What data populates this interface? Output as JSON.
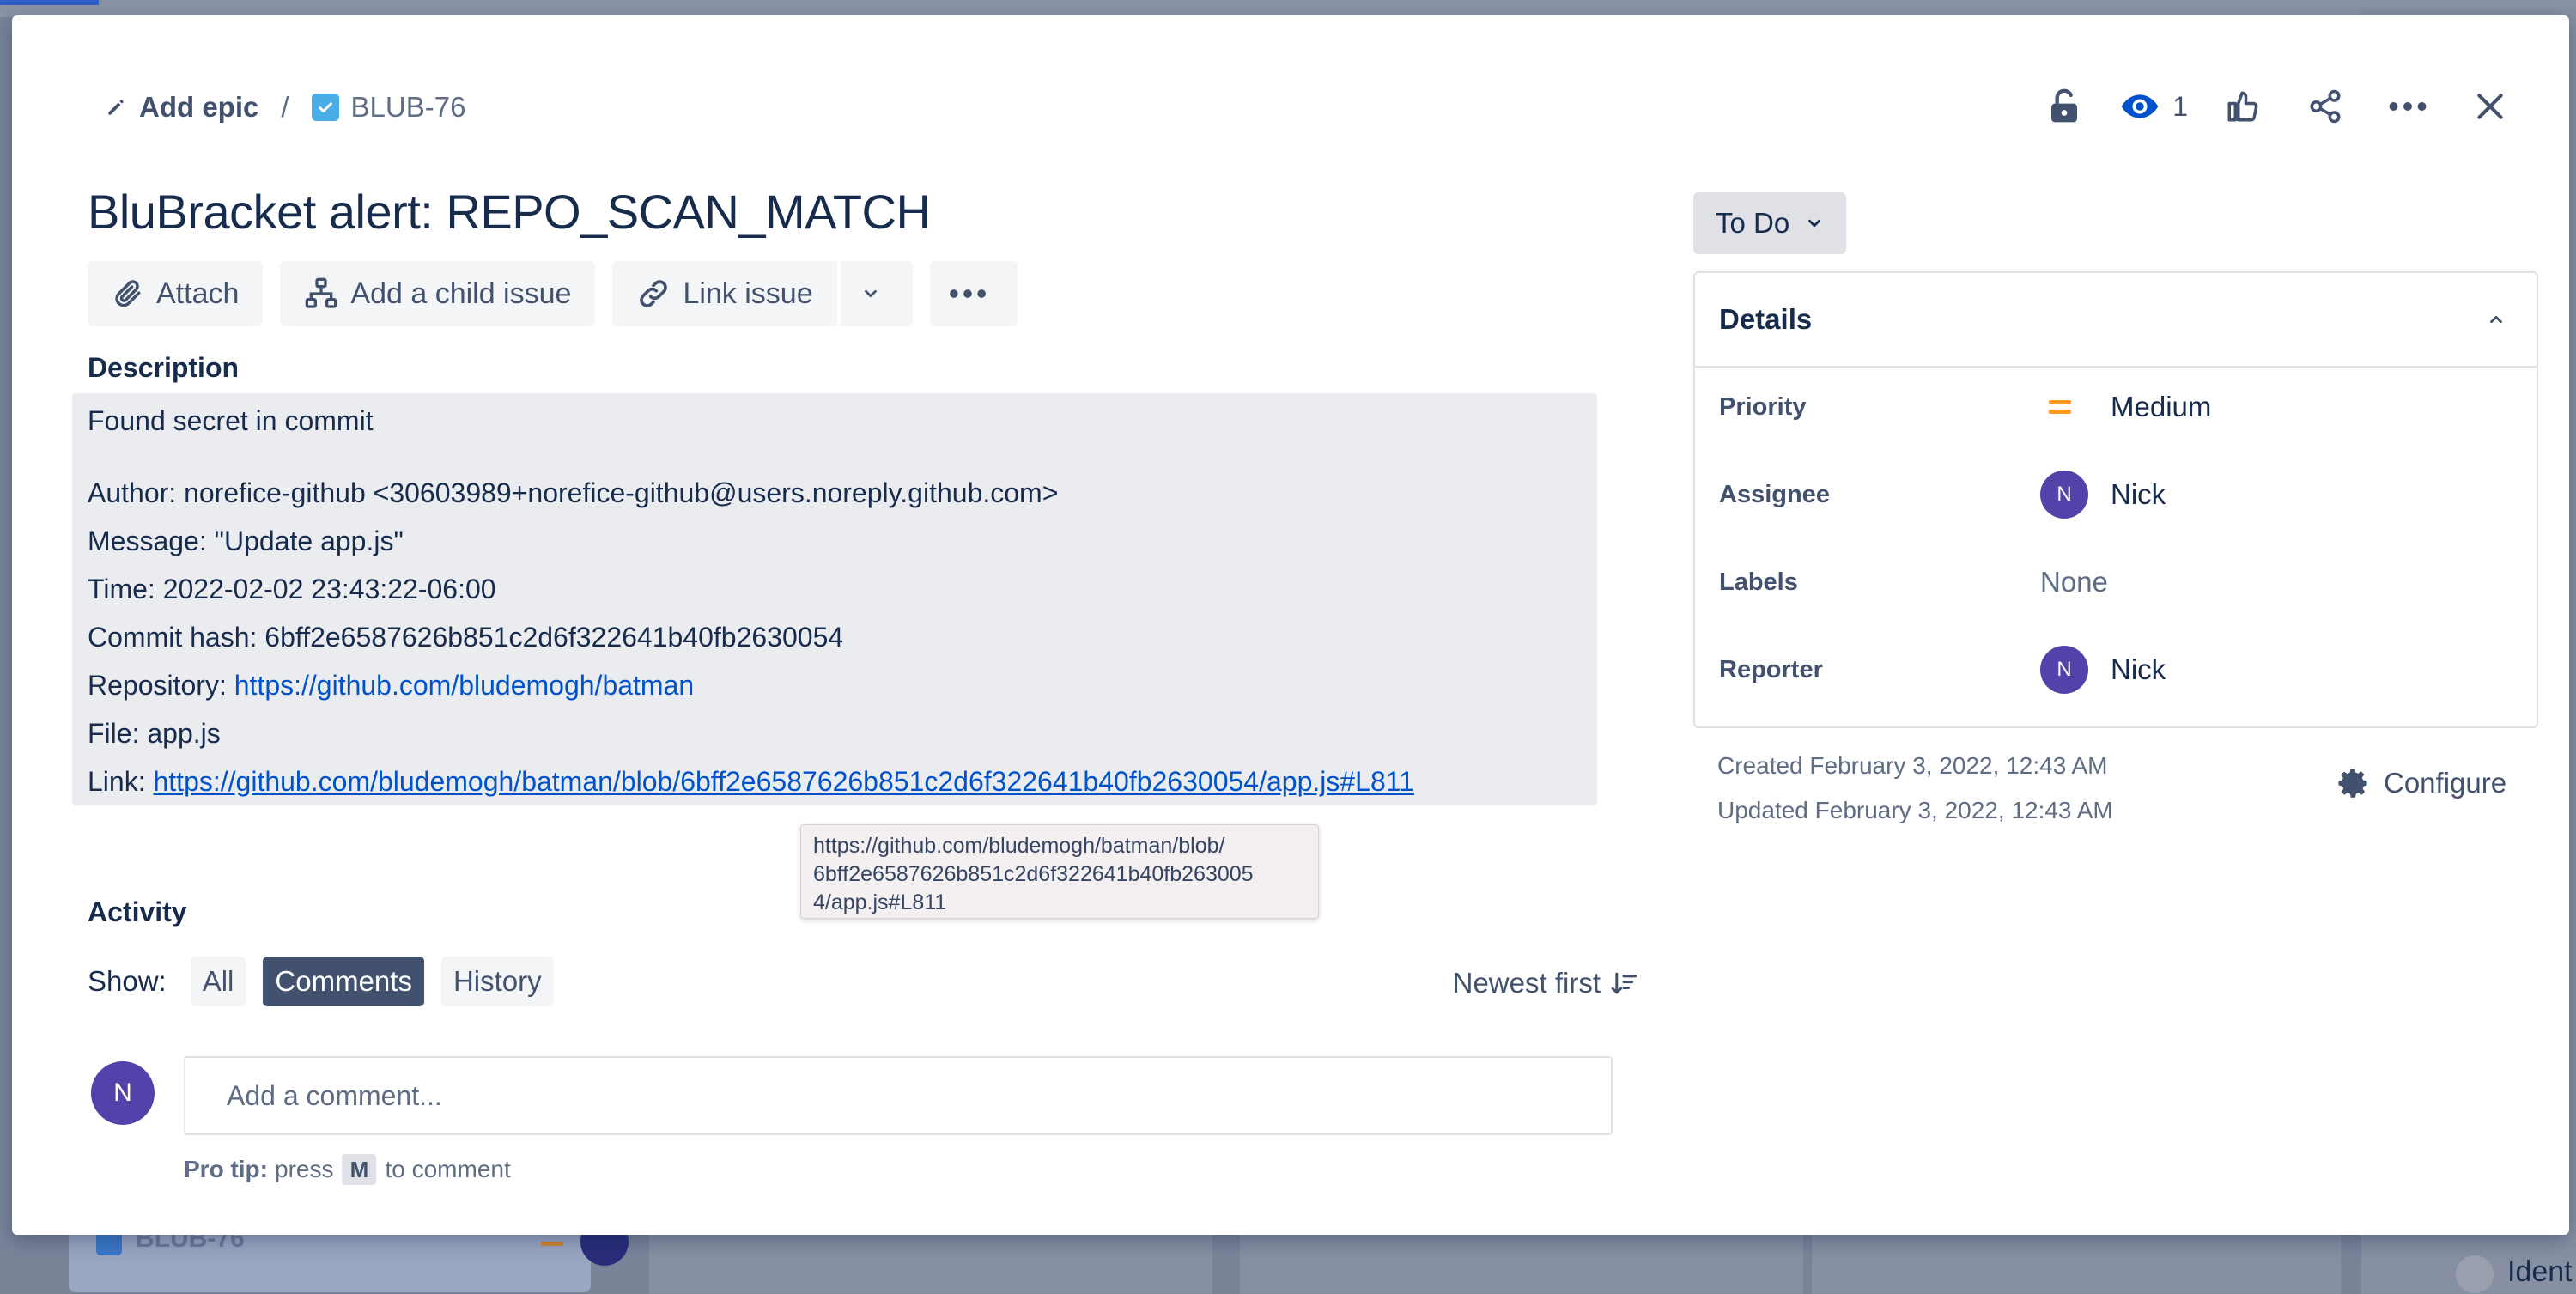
{
  "breadcrumb": {
    "epic_label": "Add epic",
    "separator": "/",
    "issue_key": "BLUB-76"
  },
  "top_actions": {
    "watchers_count": "1"
  },
  "issue": {
    "title": "BluBracket alert: REPO_SCAN_MATCH"
  },
  "toolbar": {
    "attach": "Attach",
    "add_child": "Add a child issue",
    "link_issue": "Link issue"
  },
  "description": {
    "heading": "Description",
    "intro": "Found secret in commit",
    "author": "Author: norefice-github <30603989+norefice-github@users.noreply.github.com>",
    "message": "Message: \"Update app.js\"",
    "time": "Time: 2022-02-02 23:43:22-06:00",
    "commit": "Commit hash: 6bff2e6587626b851c2d6f322641b40fb2630054",
    "repo_prefix": "Repository: ",
    "repo_url": "https://github.com/bludemogh/batman",
    "file": "File: app.js",
    "link_prefix": "Link: ",
    "link_url": "https://github.com/bludemogh/batman/blob/6bff2e6587626b851c2d6f322641b40fb2630054/app.js#L811"
  },
  "tooltip": {
    "text": "https://github.com/bludemogh/batman/blob/\n6bff2e6587626b851c2d6f322641b40fb263005\n4/app.js#L811"
  },
  "activity": {
    "heading": "Activity",
    "show_label": "Show:",
    "filters": [
      "All",
      "Comments",
      "History"
    ],
    "active_filter": "Comments",
    "sort_label": "Newest first"
  },
  "comment": {
    "avatar_initial": "N",
    "placeholder": "Add a comment...",
    "protip_bold": "Pro tip:",
    "protip_pre": "press",
    "protip_key": "M",
    "protip_post": "to comment"
  },
  "status": {
    "label": "To Do"
  },
  "details": {
    "heading": "Details",
    "priority_label": "Priority",
    "priority_value": "Medium",
    "priority_color": "#ff991f",
    "assignee_label": "Assignee",
    "assignee_value": "Nick",
    "assignee_initial": "N",
    "labels_label": "Labels",
    "labels_value": "None",
    "reporter_label": "Reporter",
    "reporter_value": "Nick",
    "reporter_initial": "N"
  },
  "meta": {
    "created": "Created February 3, 2022, 12:43 AM",
    "updated": "Updated February 3, 2022, 12:43 AM",
    "configure": "Configure"
  },
  "background": {
    "card_key": "BLUB-76",
    "right_text": "Ident"
  },
  "colors": {
    "accent": "#0052cc",
    "avatar": "#5243aa",
    "text": "#172b4d"
  }
}
